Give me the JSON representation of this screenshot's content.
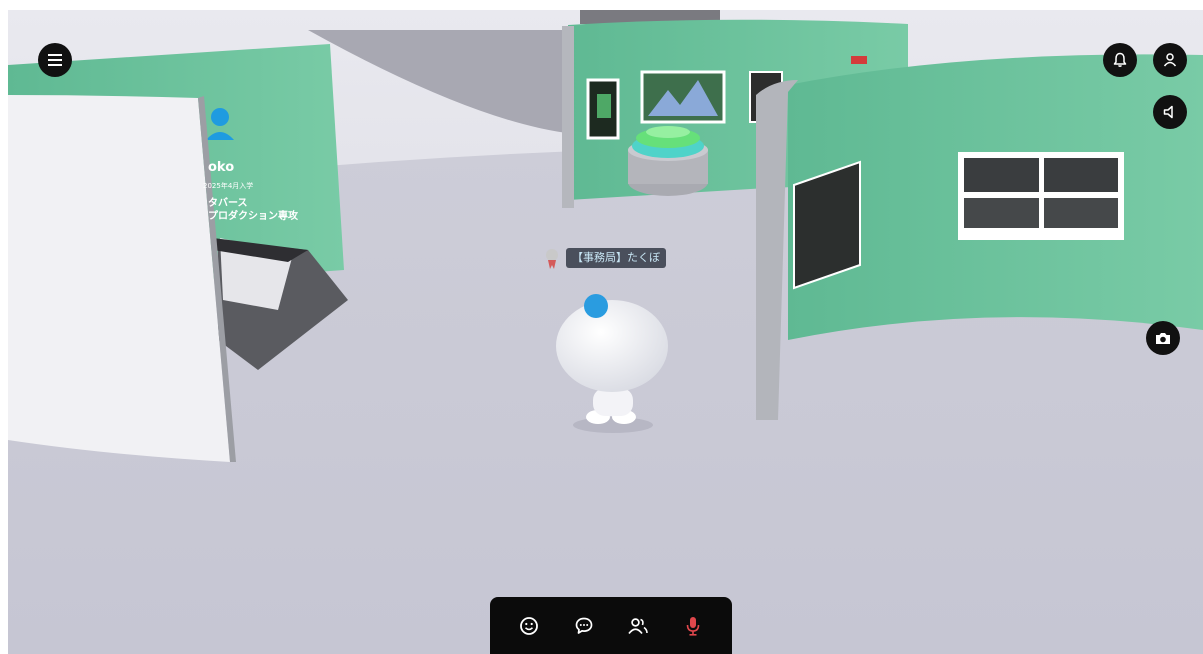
{
  "hud": {
    "menu_icon": "hamburger-menu-icon",
    "notification_icon": "bell-icon",
    "profile_icon": "user-icon",
    "sound_icon": "speaker-icon",
    "camera_icon": "camera-icon"
  },
  "avatar": {
    "name_tag": "【事務局】たくぼ"
  },
  "left_panel": {
    "name": "oko",
    "date": "2025年4月入学",
    "line1": "タバース",
    "line2": "プロダクション専攻"
  },
  "toolbar": {
    "items": [
      {
        "icon": "smiley-emote-icon"
      },
      {
        "icon": "chat-bubble-icon"
      },
      {
        "icon": "users-icon"
      },
      {
        "icon": "microphone-muted-icon",
        "color": "#e0474c"
      }
    ]
  },
  "colors": {
    "floor": "#c9c9d6",
    "wall_green": "#6cc39c",
    "hud_black": "#111111",
    "nametag_bg": "#4a4f5c",
    "avatar_dot": "#2a9ce0"
  }
}
